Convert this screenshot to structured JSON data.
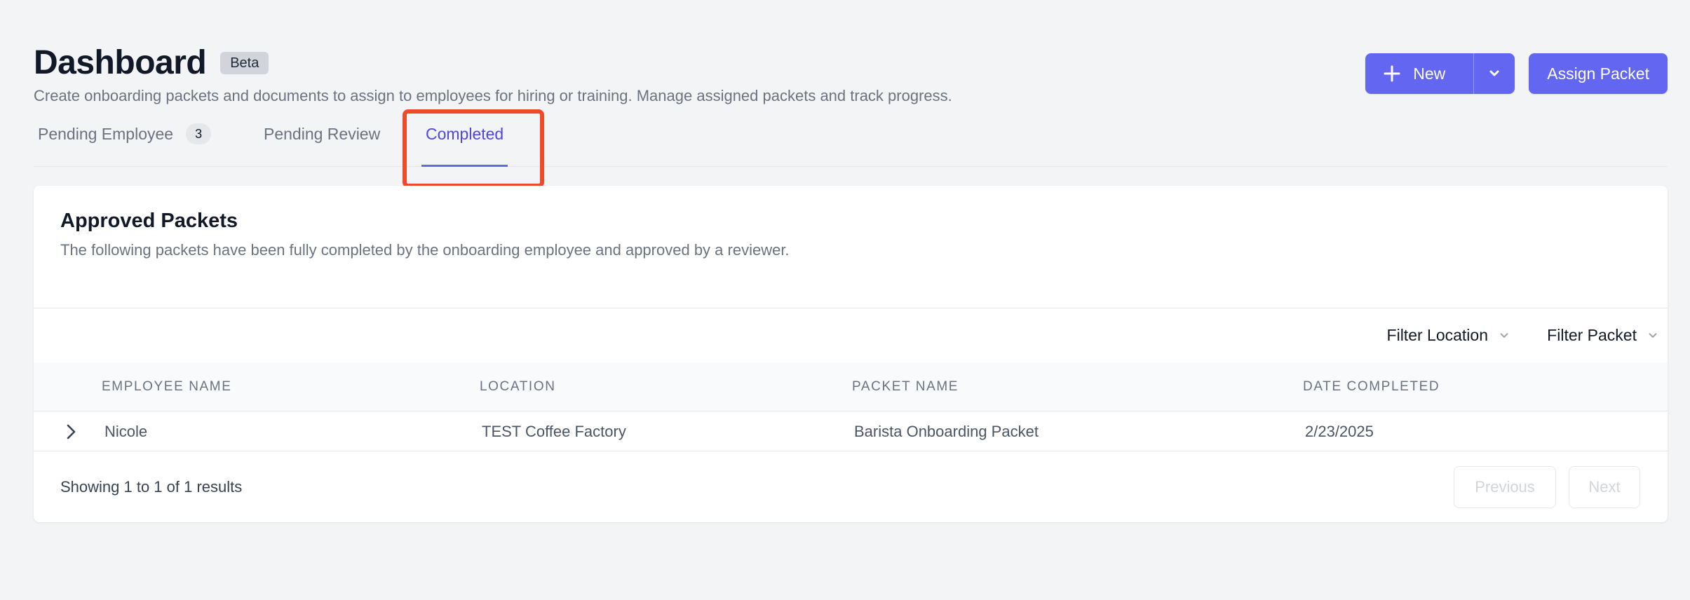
{
  "header": {
    "title": "Dashboard",
    "badge": "Beta",
    "subtitle": "Create onboarding packets and documents to assign to employees for hiring or training. Manage assigned packets and track progress."
  },
  "actions": {
    "new_label": "New",
    "assign_label": "Assign Packet"
  },
  "tabs": [
    {
      "label": "Pending Employee",
      "count": "3"
    },
    {
      "label": "Pending Review"
    },
    {
      "label": "Completed",
      "active": true
    }
  ],
  "card": {
    "title": "Approved Packets",
    "description": "The following packets have been fully completed by the onboarding employee and approved by a reviewer."
  },
  "filters": {
    "location": "Filter Location",
    "packet": "Filter Packet"
  },
  "table": {
    "columns": [
      "EMPLOYEE NAME",
      "LOCATION",
      "PACKET NAME",
      "DATE COMPLETED"
    ],
    "rows": [
      {
        "employee": "Nicole",
        "location": "TEST Coffee Factory",
        "packet": "Barista Onboarding Packet",
        "date": "2/23/2025"
      }
    ]
  },
  "pagination": {
    "summary": "Showing 1 to 1 of 1 results",
    "previous": "Previous",
    "next": "Next"
  },
  "colors": {
    "accent": "#6366f1",
    "active_tab": "#4f46e5",
    "highlight": "#f04a2a"
  },
  "icons": {
    "new": "plus-icon",
    "dropdown": "chevron-down-icon",
    "expand": "chevron-right-icon"
  }
}
